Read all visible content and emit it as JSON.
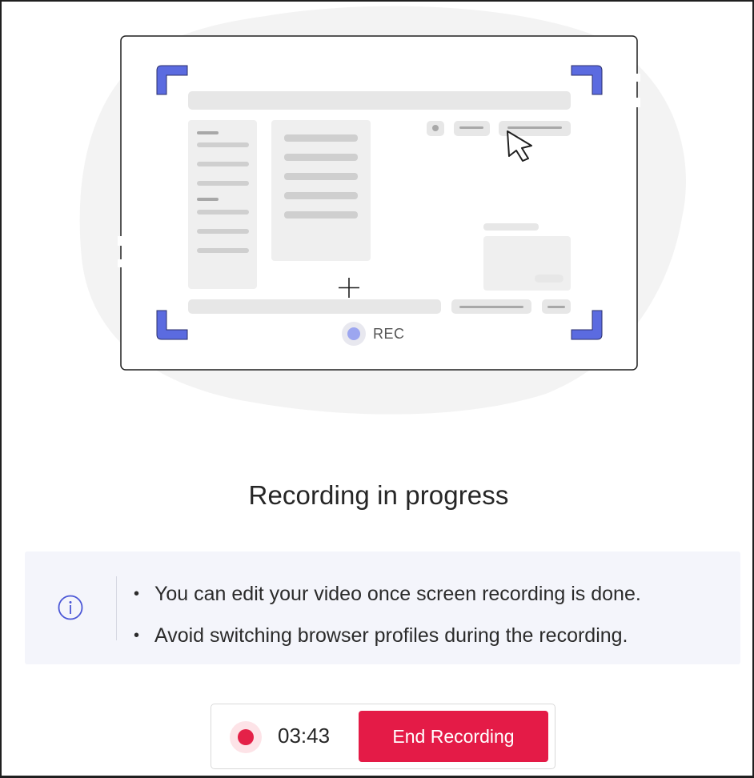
{
  "illustration": {
    "rec_label": "REC"
  },
  "title": "Recording in progress",
  "info": {
    "icon": "info-icon",
    "items": [
      "You can edit your video once screen recording is done.",
      "Avoid switching browser profiles during the recording."
    ]
  },
  "recorder": {
    "timer": "03:43",
    "end_button_label": "End Recording"
  },
  "colors": {
    "accent": "#5b6be0",
    "danger": "#e41b47",
    "info_bg": "#f4f5fb"
  }
}
